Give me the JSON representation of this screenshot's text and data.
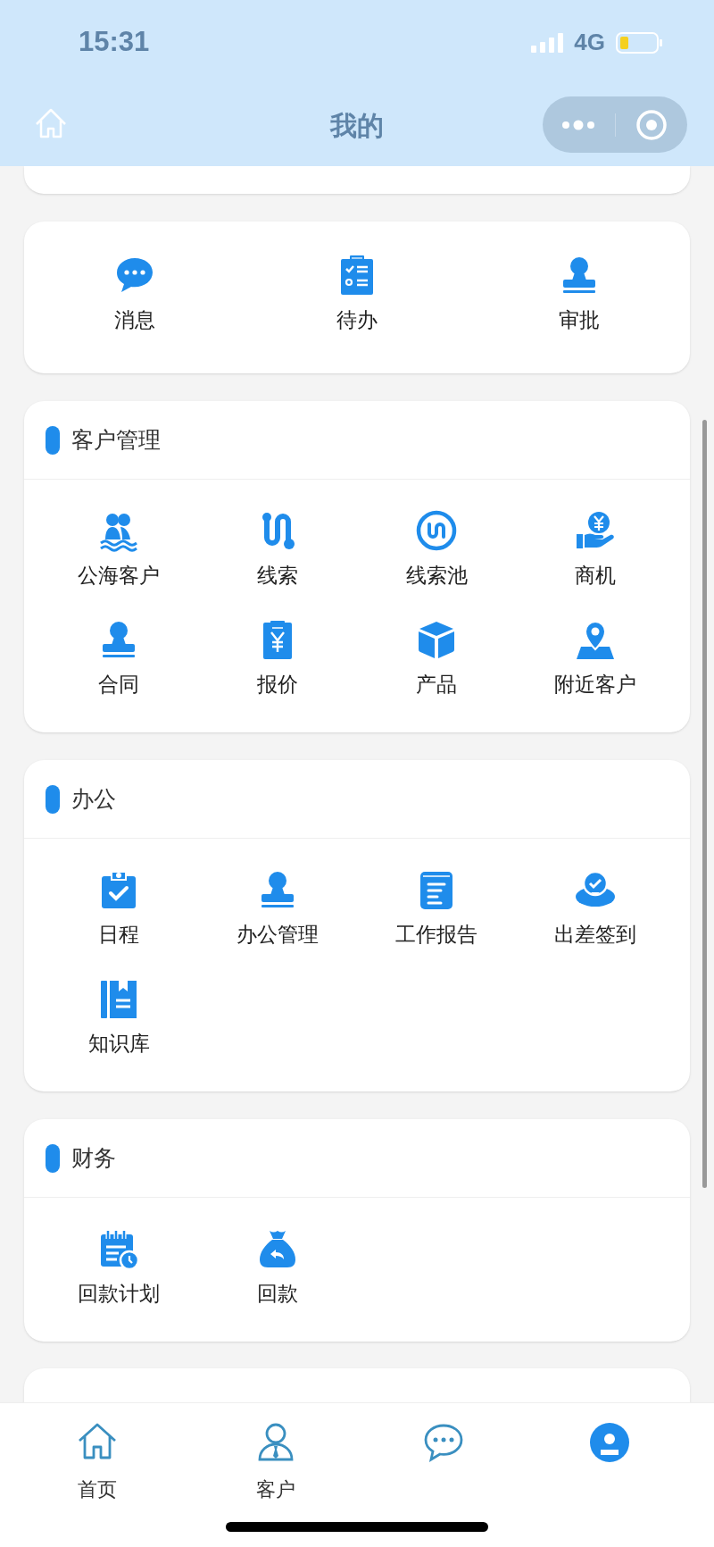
{
  "status_bar": {
    "time": "15:31",
    "network": "4G"
  },
  "nav_bar": {
    "title": "我的"
  },
  "quick_actions": [
    {
      "label": "消息"
    },
    {
      "label": "待办"
    },
    {
      "label": "审批"
    }
  ],
  "sections": [
    {
      "title": "客户管理",
      "items": [
        {
          "label": "公海客户"
        },
        {
          "label": "线索"
        },
        {
          "label": "线索池"
        },
        {
          "label": "商机"
        },
        {
          "label": "合同"
        },
        {
          "label": "报价"
        },
        {
          "label": "产品"
        },
        {
          "label": "附近客户"
        }
      ]
    },
    {
      "title": "办公",
      "items": [
        {
          "label": "日程"
        },
        {
          "label": "办公管理"
        },
        {
          "label": "工作报告"
        },
        {
          "label": "出差签到"
        },
        {
          "label": "知识库"
        }
      ]
    },
    {
      "title": "财务",
      "items": [
        {
          "label": "回款计划"
        },
        {
          "label": "回款"
        }
      ]
    }
  ],
  "tab_bar": [
    {
      "label": "首页",
      "selected": false
    },
    {
      "label": "客户",
      "selected": false
    },
    {
      "selected": false
    },
    {
      "selected": true
    }
  ]
}
